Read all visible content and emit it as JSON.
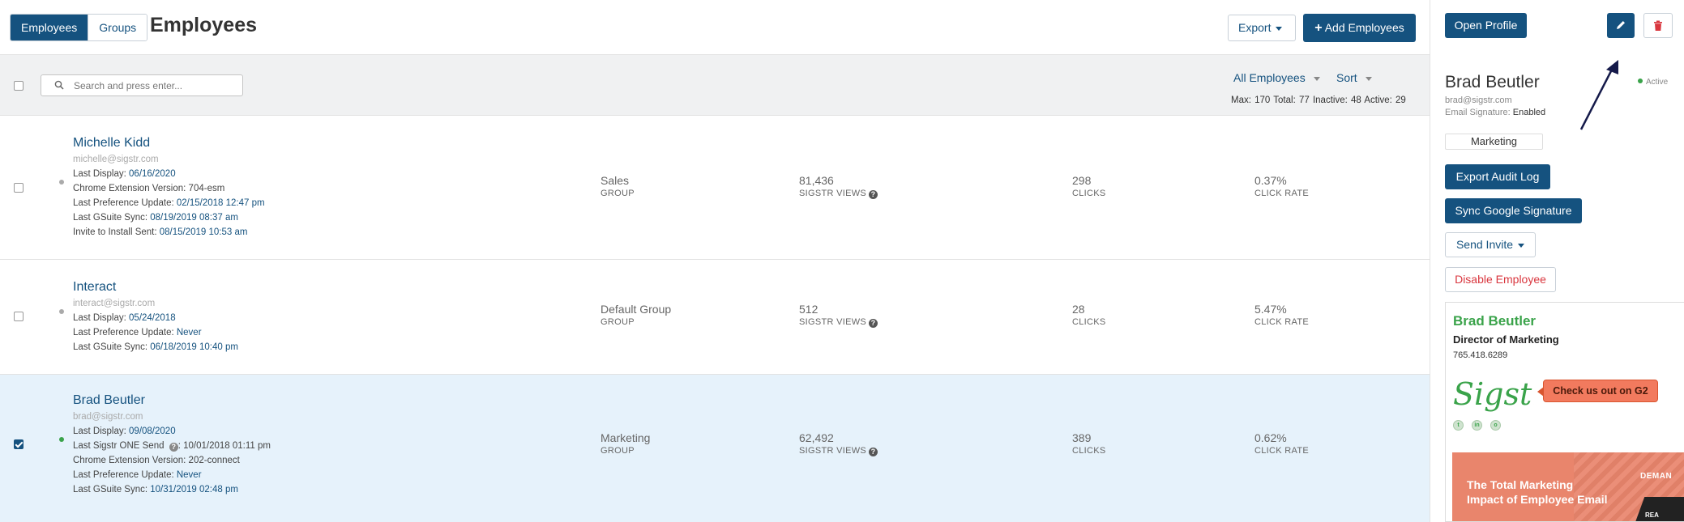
{
  "header": {
    "tabs": [
      {
        "label": "Employees",
        "active": true
      },
      {
        "label": "Groups",
        "active": false
      }
    ],
    "title": "Employees",
    "export_label": "Export",
    "add_label": "Add Employees"
  },
  "toolbar": {
    "search_placeholder": "Search and press enter...",
    "filter_label": "All Employees",
    "sort_label": "Sort",
    "stats": "Max: 170  Total: 77  Inactive: 48  Active: 29"
  },
  "rows": [
    {
      "name": "Michelle Kidd",
      "email": "michelle@sigstr.com",
      "selected": false,
      "status": "inactive",
      "details": [
        {
          "label": "Last Display: ",
          "value": "06/16/2020",
          "link": true
        },
        {
          "label": "Chrome Extension Version: ",
          "value": "704-esm",
          "link": false
        },
        {
          "label": "Last Preference Update: ",
          "value": "02/15/2018 12:47 pm",
          "link": true
        },
        {
          "label": "Last GSuite Sync: ",
          "value": "08/19/2019 08:37 am",
          "link": true
        },
        {
          "label": "Invite to Install Sent: ",
          "value": "08/15/2019 10:53 am",
          "link": true
        }
      ],
      "group": "Sales",
      "group_label": "GROUP",
      "views": "81,436",
      "views_label": "SIGSTR VIEWS",
      "clicks": "298",
      "clicks_label": "CLICKS",
      "rate": "0.37%",
      "rate_label": "CLICK RATE"
    },
    {
      "name": "Interact",
      "email": "interact@sigstr.com",
      "selected": false,
      "status": "inactive",
      "details": [
        {
          "label": "Last Display: ",
          "value": "05/24/2018",
          "link": true
        },
        {
          "label": "Last Preference Update: ",
          "value": "Never",
          "link": true
        },
        {
          "label": "Last GSuite Sync: ",
          "value": "06/18/2019 10:40 pm",
          "link": true
        }
      ],
      "group": "Default Group",
      "group_label": "GROUP",
      "views": "512",
      "views_label": "SIGSTR VIEWS",
      "clicks": "28",
      "clicks_label": "CLICKS",
      "rate": "5.47%",
      "rate_label": "CLICK RATE"
    },
    {
      "name": "Brad Beutler",
      "email": "brad@sigstr.com",
      "selected": true,
      "status": "active",
      "details": [
        {
          "label": "Last Display: ",
          "value": "09/08/2020",
          "link": true
        },
        {
          "label": "Last Sigstr ONE Send ",
          "value": ": 10/01/2018 01:11 pm",
          "link": false
        },
        {
          "label": "Chrome Extension Version: ",
          "value": "202-connect",
          "link": false
        },
        {
          "label": "Last Preference Update: ",
          "value": "Never",
          "link": true
        },
        {
          "label": "Last GSuite Sync: ",
          "value": "10/31/2019 02:48 pm",
          "link": true
        }
      ],
      "group": "Marketing",
      "group_label": "GROUP",
      "views": "62,492",
      "views_label": "SIGSTR VIEWS",
      "clicks": "389",
      "clicks_label": "CLICKS",
      "rate": "0.62%",
      "rate_label": "CLICK RATE"
    }
  ],
  "panel": {
    "open_profile_label": "Open Profile",
    "name": "Brad Beutler",
    "email": "brad@sigstr.com",
    "sig_label": "Email Signature: ",
    "sig_value": "Enabled",
    "status": "Active",
    "group_tag": "Marketing",
    "export_audit_label": "Export Audit Log",
    "sync_google_label": "Sync Google Signature",
    "send_invite_label": "Send Invite",
    "disable_label": "Disable Employee",
    "signature": {
      "name": "Brad Beutler",
      "title": "Director of Marketing",
      "phone": "765.418.6289",
      "logo_text": "Sigstr",
      "cta": "Check us out on G2",
      "banner_text_1": "The Total Marketing",
      "banner_text_2": "Impact of Employee Email",
      "banner_right": "DEMAN",
      "banner_sub": "REA"
    }
  },
  "colors": {
    "primary": "#15527f",
    "active": "#3aa34a",
    "danger": "#d9363e",
    "selected_row": "#e6f2fb"
  }
}
